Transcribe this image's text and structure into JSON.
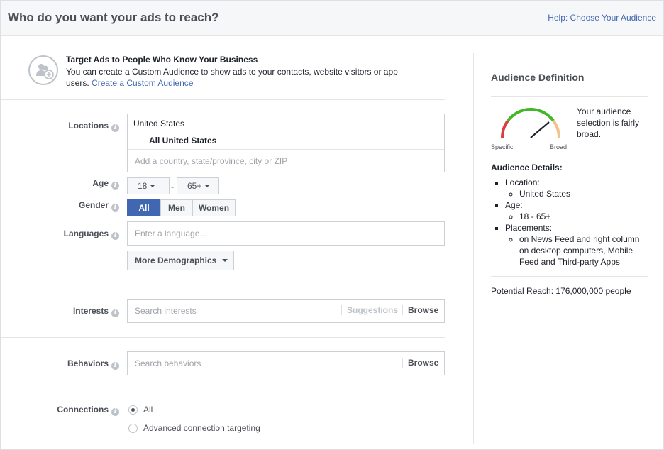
{
  "header": {
    "title": "Who do you want your ads to reach?",
    "help_link": "Help: Choose Your Audience"
  },
  "custom_audience": {
    "title": "Target Ads to People Who Know Your Business",
    "text": "You can create a Custom Audience to show ads to your contacts, website visitors or app users.",
    "link": "Create a Custom Audience"
  },
  "locations": {
    "label": "Locations",
    "country": "United States",
    "scope": "All United States",
    "placeholder": "Add a country, state/province, city or ZIP"
  },
  "age": {
    "label": "Age",
    "min": "18",
    "separator": "-",
    "max": "65+"
  },
  "gender": {
    "label": "Gender",
    "options": [
      "All",
      "Men",
      "Women"
    ],
    "selected": "All"
  },
  "languages": {
    "label": "Languages",
    "placeholder": "Enter a language..."
  },
  "more_demographics": "More Demographics",
  "interests": {
    "label": "Interests",
    "placeholder": "Search interests",
    "suggestions": "Suggestions",
    "browse": "Browse"
  },
  "behaviors": {
    "label": "Behaviors",
    "placeholder": "Search behaviors",
    "browse": "Browse"
  },
  "connections": {
    "label": "Connections",
    "options": [
      "All",
      "Advanced connection targeting"
    ],
    "selected": "All"
  },
  "audience_definition": {
    "title": "Audience Definition",
    "gauge_low": "Specific",
    "gauge_high": "Broad",
    "summary": "Your audience selection is fairly broad.",
    "details_title": "Audience Details:",
    "details": [
      {
        "label": "Location:",
        "values": [
          "United States"
        ]
      },
      {
        "label": "Age:",
        "values": [
          "18 - 65+"
        ]
      },
      {
        "label": "Placements:",
        "values": [
          "on News Feed and right column on desktop computers, Mobile Feed and Third-party Apps"
        ]
      }
    ],
    "potential_reach": "Potential Reach: 176,000,000 people"
  },
  "colors": {
    "accent": "#4267b2",
    "gauge_red": "#d93f3f",
    "gauge_green": "#42b72a",
    "gauge_orange": "#f5c18b"
  }
}
